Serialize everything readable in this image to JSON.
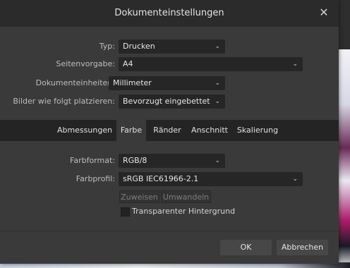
{
  "dialog": {
    "title": "Dokumenteinstellungen",
    "close_glyph": "✕"
  },
  "general": {
    "type": {
      "label": "Typ:",
      "value": "Drucken"
    },
    "page_preset": {
      "label": "Seitenvorgabe:",
      "value": "A4"
    },
    "doc_units": {
      "label": "Dokumenteinheiten:",
      "value": "Millimeter"
    },
    "images": {
      "label": "Bilder wie folgt platzieren:",
      "value": "Bevorzugt eingebettet"
    }
  },
  "tabs": [
    {
      "label": "Abmessungen",
      "active": false
    },
    {
      "label": "Farbe",
      "active": true
    },
    {
      "label": "Ränder",
      "active": false
    },
    {
      "label": "Anschnitt",
      "active": false
    },
    {
      "label": "Skalierung",
      "active": false
    }
  ],
  "color": {
    "format": {
      "label": "Farbformat:",
      "value": "RGB/8"
    },
    "profile": {
      "label": "Farbprofil:",
      "value": "sRGB IEC61966-2.1"
    },
    "assign_label": "Zuweisen",
    "convert_label": "Umwandeln",
    "transparent_label": "Transparenter Hintergrund",
    "transparent_checked": false
  },
  "footer": {
    "ok_label": "OK",
    "cancel_label": "Abbrechen"
  },
  "icons": {
    "chevron": "⌄"
  }
}
